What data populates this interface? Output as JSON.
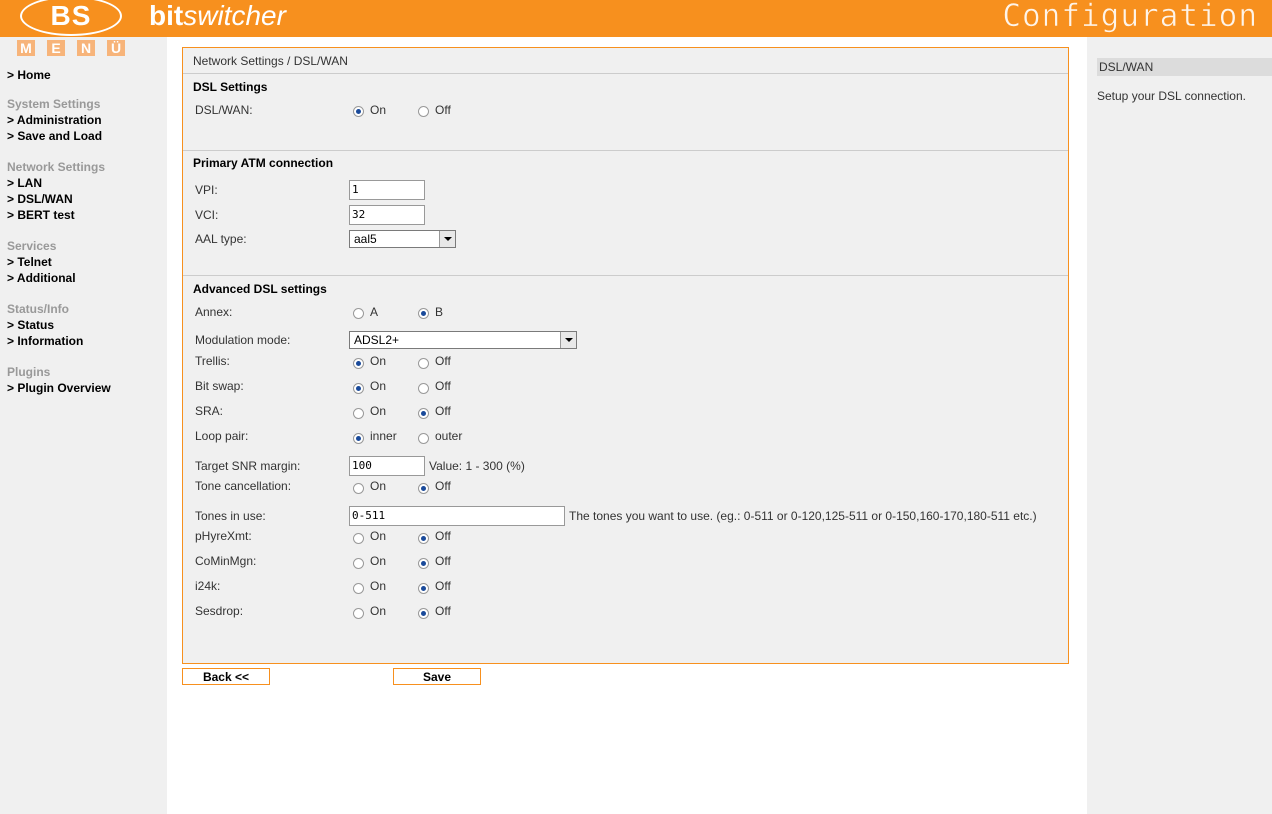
{
  "header": {
    "logo": "BS",
    "brand_bold": "bit",
    "brand_italic": "switcher",
    "title": "Configuration"
  },
  "sidebar": {
    "menu_letters": [
      "M",
      "E",
      "N",
      "Ü"
    ],
    "home": "> Home",
    "groups": [
      {
        "heading": "System Settings",
        "links": [
          "> Administration",
          "> Save and Load"
        ]
      },
      {
        "heading": "Network Settings",
        "links": [
          "> LAN",
          "> DSL/WAN",
          "> BERT test"
        ]
      },
      {
        "heading": "Services",
        "links": [
          "> Telnet",
          "> Additional"
        ]
      },
      {
        "heading": "Status/Info",
        "links": [
          "> Status",
          "> Information"
        ]
      },
      {
        "heading": "Plugins",
        "links": [
          "> Plugin Overview"
        ]
      }
    ]
  },
  "breadcrumb": "Network Settings / DSL/WAN",
  "sections": {
    "dsl": {
      "title": "DSL Settings",
      "dslwan_label": "DSL/WAN:",
      "on": "On",
      "off": "Off",
      "selected": "on"
    },
    "atm": {
      "title": "Primary ATM connection",
      "vpi_label": "VPI:",
      "vpi_value": "1",
      "vci_label": "VCI:",
      "vci_value": "32",
      "aal_label": "AAL type:",
      "aal_value": "aal5"
    },
    "advanced": {
      "title": "Advanced DSL settings",
      "annex_label": "Annex:",
      "annex_a": "A",
      "annex_b": "B",
      "modulation_label": "Modulation mode:",
      "modulation_value": "ADSL2+",
      "trellis_label": "Trellis:",
      "bitswap_label": "Bit swap:",
      "sra_label": "SRA:",
      "looppair_label": "Loop pair:",
      "loop_inner": "inner",
      "loop_outer": "outer",
      "snr_label": "Target SNR margin:",
      "snr_value": "100",
      "snr_hint": "Value: 1 - 300 (%)",
      "tone_label": "Tone cancellation:",
      "tones_label": "Tones in use:",
      "tones_value": "0-511",
      "tones_hint": "The tones you want to use. (eg.: 0-511 or 0-120,125-511 or 0-150,160-170,180-511 etc.)",
      "phyre_label": "pHyreXmt:",
      "comin_label": "CoMinMgn:",
      "i24k_label": "i24k:",
      "sesdrop_label": "Sesdrop:",
      "on": "On",
      "off": "Off"
    }
  },
  "buttons": {
    "back": "Back <<",
    "save": "Save"
  },
  "help": {
    "title": "DSL/WAN",
    "text": "Setup your DSL connection."
  },
  "colors": {
    "accent": "#f7901e",
    "radio_dot": "#1a4a9a",
    "panel_bg": "#f0f0f0"
  }
}
